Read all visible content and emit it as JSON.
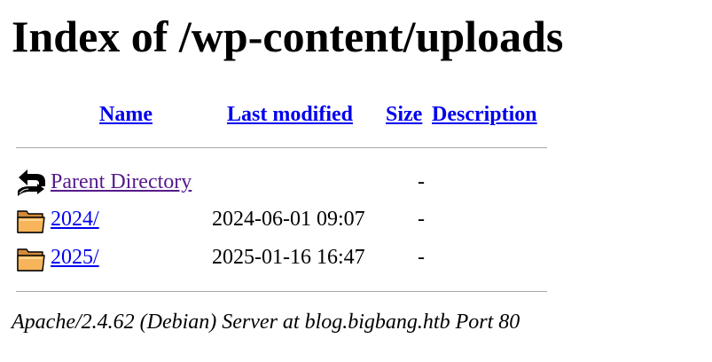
{
  "page": {
    "title": "Index of /wp-content/uploads"
  },
  "table": {
    "headers": {
      "name": "Name",
      "last_modified": "Last modified",
      "size": "Size",
      "description": "Description"
    },
    "rows": [
      {
        "icon": "back-icon",
        "name": "Parent Directory",
        "last_modified": "",
        "size": "-",
        "description": ""
      },
      {
        "icon": "folder-icon",
        "name": "2024/",
        "last_modified": "2024-06-01 09:07",
        "size": "-",
        "description": ""
      },
      {
        "icon": "folder-icon",
        "name": "2025/",
        "last_modified": "2025-01-16 16:47",
        "size": "-",
        "description": ""
      }
    ]
  },
  "footer": {
    "signature": "Apache/2.4.62 (Debian) Server at blog.bigbang.htb Port 80"
  },
  "colors": {
    "link": "#0000ee",
    "visited_link": "#551a8b",
    "rule": "#a8a8a8"
  }
}
